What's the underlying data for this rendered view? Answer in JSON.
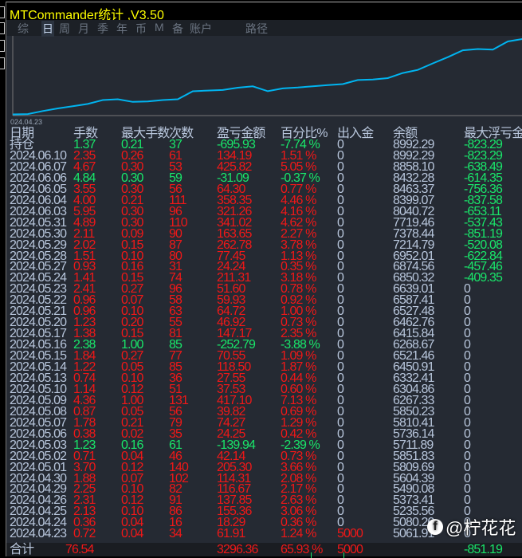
{
  "title": "MTCommander统计 ,V3.50",
  "menu": [
    {
      "label": "综",
      "active": false
    },
    {
      "label": "日",
      "active": true
    },
    {
      "label": "周",
      "active": false
    },
    {
      "label": "月",
      "active": false
    },
    {
      "label": "季",
      "active": false
    },
    {
      "label": "年",
      "active": false
    },
    {
      "label": "币",
      "active": false
    },
    {
      "label": "M",
      "active": false
    },
    {
      "label": "备",
      "active": false
    },
    {
      "label": "账户",
      "active": false
    },
    {
      "label": "路径",
      "active": false
    }
  ],
  "chart": {
    "start_label": "024.04.23",
    "color": "#00b4f0"
  },
  "headers": [
    "日期",
    "手数",
    "最大手数",
    "次数",
    "盈亏金额",
    "百分比%",
    "出入金",
    "余额",
    "最大浮亏金"
  ],
  "rows": [
    [
      "持仓",
      "1.37",
      "0.21",
      "37",
      "-695.93",
      "-7.74 %",
      "0",
      "8992.29",
      "-823.29"
    ],
    [
      "2024.06.10",
      "2.35",
      "0.26",
      "61",
      "134.19",
      "1.51 %",
      "0",
      "8992.29",
      "-823.29"
    ],
    [
      "2024.06.07",
      "4.67",
      "0.30",
      "53",
      "425.82",
      "5.05 %",
      "0",
      "8858.10",
      "-638.49"
    ],
    [
      "2024.06.06",
      "4.84",
      "0.30",
      "59",
      "-31.09",
      "-0.37 %",
      "0",
      "8432.28",
      "-614.35"
    ],
    [
      "2024.06.05",
      "3.55",
      "0.30",
      "56",
      "64.30",
      "0.77 %",
      "0",
      "8463.37",
      "-756.36"
    ],
    [
      "2024.06.04",
      "4.00",
      "0.21",
      "111",
      "358.35",
      "4.46 %",
      "0",
      "8399.07",
      "-837.58"
    ],
    [
      "2024.06.03",
      "5.95",
      "0.30",
      "96",
      "321.26",
      "4.16 %",
      "0",
      "8040.72",
      "-653.11"
    ],
    [
      "2024.05.31",
      "4.89",
      "0.30",
      "110",
      "341.02",
      "4.62 %",
      "0",
      "7719.46",
      "-537.43"
    ],
    [
      "2024.05.30",
      "2.11",
      "0.09",
      "90",
      "163.65",
      "2.27 %",
      "0",
      "7378.44",
      "-851.19"
    ],
    [
      "2024.05.29",
      "2.02",
      "0.15",
      "87",
      "262.78",
      "3.78 %",
      "0",
      "7214.79",
      "-520.08"
    ],
    [
      "2024.05.28",
      "1.51",
      "0.10",
      "80",
      "77.45",
      "1.13 %",
      "0",
      "6952.01",
      "-622.84"
    ],
    [
      "2024.05.27",
      "0.93",
      "0.16",
      "31",
      "24.24",
      "0.35 %",
      "0",
      "6874.56",
      "-457.46"
    ],
    [
      "2024.05.24",
      "1.41",
      "0.15",
      "74",
      "211.31",
      "3.18 %",
      "0",
      "6850.32",
      "-409.35"
    ],
    [
      "2024.05.23",
      "2.41",
      "0.27",
      "96",
      "51.60",
      "0.78 %",
      "0",
      "6639.01",
      "0"
    ],
    [
      "2024.05.22",
      "0.96",
      "0.07",
      "58",
      "59.93",
      "0.92 %",
      "0",
      "6587.41",
      "0"
    ],
    [
      "2024.05.21",
      "0.96",
      "0.10",
      "63",
      "64.72",
      "1.00 %",
      "0",
      "6527.48",
      "0"
    ],
    [
      "2024.05.20",
      "1.23",
      "0.20",
      "55",
      "46.92",
      "0.73 %",
      "0",
      "6462.76",
      "0"
    ],
    [
      "2024.05.17",
      "1.38",
      "0.15",
      "81",
      "147.17",
      "2.35 %",
      "0",
      "6415.84",
      "0"
    ],
    [
      "2024.05.16",
      "2.38",
      "1.00",
      "85",
      "-252.79",
      "-3.88 %",
      "0",
      "6268.67",
      "0"
    ],
    [
      "2024.05.15",
      "1.84",
      "0.27",
      "77",
      "70.55",
      "1.09 %",
      "0",
      "6521.46",
      "0"
    ],
    [
      "2024.05.14",
      "1.22",
      "0.05",
      "85",
      "118.50",
      "1.87 %",
      "0",
      "6450.91",
      "0"
    ],
    [
      "2024.05.13",
      "0.74",
      "0.10",
      "36",
      "27.55",
      "0.44 %",
      "0",
      "6332.41",
      "0"
    ],
    [
      "2024.05.10",
      "1.14",
      "0.12",
      "51",
      "37.53",
      "0.60 %",
      "0",
      "6304.86",
      "0"
    ],
    [
      "2024.05.09",
      "4.36",
      "1.00",
      "131",
      "417.10",
      "7.13 %",
      "0",
      "6267.33",
      "0"
    ],
    [
      "2024.05.08",
      "0.87",
      "0.05",
      "56",
      "39.82",
      "0.69 %",
      "0",
      "5850.23",
      "0"
    ],
    [
      "2024.05.07",
      "1.78",
      "0.21",
      "79",
      "74.27",
      "1.29 %",
      "0",
      "5810.41",
      "0"
    ],
    [
      "2024.05.06",
      "0.38",
      "0.02",
      "35",
      "24.25",
      "0.42 %",
      "0",
      "5736.14",
      "0"
    ],
    [
      "2024.05.03",
      "1.23",
      "0.16",
      "61",
      "-139.94",
      "-2.39 %",
      "0",
      "5711.89",
      "0"
    ],
    [
      "2024.05.02",
      "0.71",
      "0.04",
      "46",
      "42.14",
      "0.73 %",
      "0",
      "5851.83",
      "0"
    ],
    [
      "2024.05.01",
      "3.70",
      "0.12",
      "140",
      "205.30",
      "3.66 %",
      "0",
      "5809.69",
      "0"
    ],
    [
      "2024.04.30",
      "1.88",
      "0.07",
      "102",
      "114.31",
      "2.08 %",
      "0",
      "5604.39",
      "0"
    ],
    [
      "2024.04.29",
      "2.25",
      "0.10",
      "82",
      "116.67",
      "2.17 %",
      "0",
      "5490.08",
      "0"
    ],
    [
      "2024.04.26",
      "2.31",
      "0.12",
      "91",
      "137.85",
      "2.63 %",
      "0",
      "5373.41",
      "0"
    ],
    [
      "2024.04.25",
      "2.13",
      "0.10",
      "86",
      "155.36",
      "3.06 %",
      "0",
      "5235.56",
      "0"
    ],
    [
      "2024.04.24",
      "0.36",
      "0.04",
      "16",
      "18.29",
      "0.36 %",
      "0",
      "5080.20",
      "0"
    ],
    [
      "2024.04.23",
      "0.72",
      "0.04",
      "34",
      "61.91",
      "1.24 %",
      "5000",
      "5061.91",
      "0"
    ]
  ],
  "total": {
    "label": "合计",
    "lots": "76.54",
    "pnl": "3296.36",
    "pct": "65.93 %",
    "deposit": "5000",
    "max_float_loss": "-851.19"
  },
  "watermark": "@柠花花",
  "colors": {
    "profit": "#f01818",
    "loss": "#19e66a",
    "neutral": "#b8c6dc",
    "title": "#ffff00"
  }
}
